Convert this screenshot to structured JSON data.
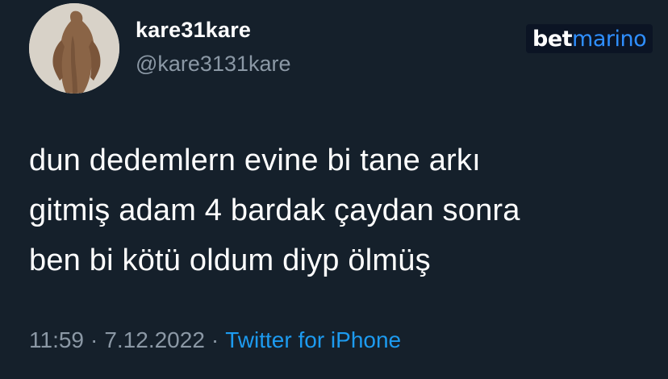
{
  "tweet": {
    "author": {
      "display_name": "kare31kare",
      "handle": "@kare3131kare",
      "avatar_icon": "avatar-image"
    },
    "brand_logo": {
      "part1": "bet",
      "part2": "marino",
      "part1_color": "#ffffff",
      "part2_color": "#2f8fff"
    },
    "text_lines": [
      "dun dedemlern evine bi tane arkı",
      "gitmiş adam 4 bardak çaydan sonra",
      "ben bi kötü oldum diyp ölmüş"
    ],
    "meta": {
      "time": "11:59",
      "separator": "·",
      "date": "7.12.2022",
      "source": "Twitter for iPhone"
    },
    "colors": {
      "background": "#15202b",
      "text": "#ffffff",
      "muted": "#8b98a5",
      "link": "#1d9bf0"
    }
  }
}
